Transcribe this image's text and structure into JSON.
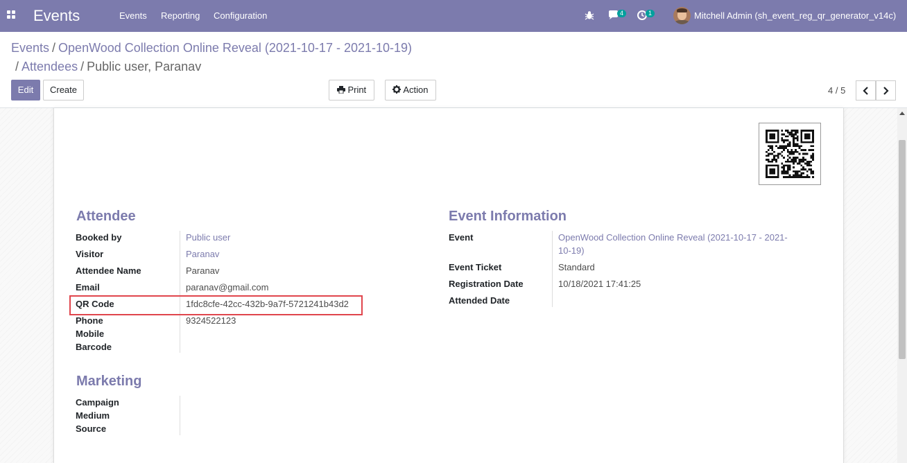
{
  "navbar": {
    "brand": "Events",
    "menu": [
      "Events",
      "Reporting",
      "Configuration"
    ],
    "messages_badge": "4",
    "activities_badge": "1",
    "user": "Mitchell Admin (sh_event_reg_qr_generator_v14c)"
  },
  "breadcrumb": {
    "root": "Events",
    "event": "OpenWood Collection Online Reveal (2021-10-17 - 2021-10-19)",
    "attendees": "Attendees",
    "current": "Public user, Paranav"
  },
  "buttons": {
    "edit": "Edit",
    "create": "Create",
    "print": "Print",
    "action": "Action"
  },
  "pager": {
    "value": "4 / 5"
  },
  "attendee": {
    "title": "Attendee",
    "fields": [
      {
        "label": "Booked by",
        "value": "Public user"
      },
      {
        "label": "Visitor",
        "value": "Paranav"
      },
      {
        "label": "Attendee Name",
        "value": "Paranav"
      },
      {
        "label": "Email",
        "value": "paranav@gmail.com"
      },
      {
        "label": "QR Code",
        "value": "1fdc8cfe-42cc-432b-9a7f-5721241b43d2"
      },
      {
        "label": "Phone",
        "value": "9324522123"
      },
      {
        "label": "Mobile",
        "value": ""
      },
      {
        "label": "Barcode",
        "value": ""
      }
    ]
  },
  "event_info": {
    "title": "Event Information",
    "fields": [
      {
        "label": "Event",
        "value": "OpenWood Collection Online Reveal (2021-10-17 - 2021-10-19)"
      },
      {
        "label": "Event Ticket",
        "value": "Standard"
      },
      {
        "label": "Registration Date",
        "value": "10/18/2021 17:41:25"
      },
      {
        "label": "Attended Date",
        "value": ""
      }
    ]
  },
  "marketing": {
    "title": "Marketing",
    "fields": [
      {
        "label": "Campaign",
        "value": ""
      },
      {
        "label": "Medium",
        "value": ""
      },
      {
        "label": "Source",
        "value": ""
      }
    ]
  },
  "colors": {
    "brand": "#7c7bad",
    "highlight": "#e0454c",
    "badge": "#00a09d"
  }
}
